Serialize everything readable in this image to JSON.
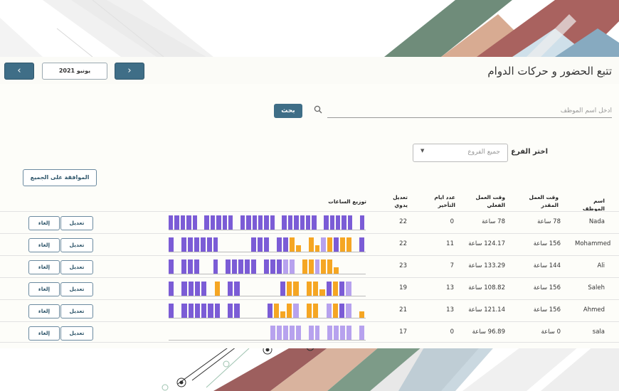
{
  "header": {
    "title": "تتبع الحضور و حركات الدوام",
    "month": "يونيو 2021",
    "prev_label": "‹",
    "next_label": "›"
  },
  "search": {
    "placeholder": "أدخل اسم الموظف",
    "button_label": "بحث"
  },
  "filter": {
    "label": "اختر الفرع",
    "selected": "جميع الفروع"
  },
  "approve_all_label": "الموافقة على الجميع",
  "table": {
    "headers": {
      "name": "اسم الموظف",
      "planned": "وقت العمل المقدر",
      "actual": "وقت العمل الفعلي",
      "late_days": "عدد ايام التأخير",
      "manual_edit": "تعديل يدوي",
      "distribution": "توزيع الساعات"
    },
    "edit_label": "تعديل",
    "cancel_label": "إلغاء",
    "rows": [
      {
        "name": "Nada",
        "planned": "78 ساعة",
        "actual": "78 ساعة",
        "late": "0",
        "manual": "22",
        "days": [
          "P",
          "P",
          "P",
          "P",
          "P",
          "E",
          "P",
          "P",
          "P",
          "P",
          "P",
          "E",
          "P",
          "P",
          "P",
          "P",
          "P",
          "P",
          "E",
          "P",
          "P",
          "P",
          "P",
          "P",
          "P",
          "E",
          "P",
          "P",
          "P",
          "P",
          "P",
          "E",
          "P"
        ]
      },
      {
        "name": "Mohammed",
        "planned": "156 ساعة",
        "actual": "124.17 ساعة",
        "late": "11",
        "manual": "22",
        "days": [
          "P",
          "E",
          "P",
          "P",
          "P",
          "P",
          "P",
          "P",
          "E",
          "E",
          "E",
          "E",
          "E",
          "P",
          "P",
          "P",
          "E",
          "P",
          "P",
          "O",
          "O",
          "E",
          "O",
          "O",
          "L",
          "O",
          "P",
          "O",
          "O",
          "E",
          "P"
        ]
      },
      {
        "name": "Ali",
        "planned": "144 ساعة",
        "actual": "133.29 ساعة",
        "late": "7",
        "manual": "23",
        "days": [
          "P",
          "E",
          "P",
          "P",
          "P",
          "E",
          "E",
          "P",
          "E",
          "P",
          "P",
          "P",
          "P",
          "P",
          "E",
          "P",
          "P",
          "P",
          "L",
          "L",
          "E",
          "O",
          "O",
          "L",
          "O",
          "O",
          "O",
          "E",
          "E",
          "E",
          "E"
        ]
      },
      {
        "name": "Saleh",
        "planned": "156 ساعة",
        "actual": "108.82 ساعة",
        "late": "13",
        "manual": "19",
        "days": [
          "P",
          "E",
          "P",
          "P",
          "P",
          "P",
          "E",
          "O",
          "E",
          "P",
          "P",
          "E",
          "E",
          "E",
          "E",
          "E",
          "E",
          "P",
          "O",
          "O",
          "E",
          "O",
          "O",
          "O",
          "P",
          "O",
          "P",
          "L",
          "E",
          "E"
        ]
      },
      {
        "name": "Ahmed",
        "planned": "156 ساعة",
        "actual": "121.14 ساعة",
        "late": "13",
        "manual": "21",
        "days": [
          "P",
          "E",
          "P",
          "P",
          "P",
          "P",
          "P",
          "P",
          "E",
          "P",
          "P",
          "E",
          "E",
          "E",
          "E",
          "P",
          "O",
          "O",
          "O",
          "L",
          "E",
          "O",
          "O",
          "E",
          "L",
          "O",
          "P",
          "L",
          "E",
          "O"
        ]
      },
      {
        "name": "sala",
        "planned": "0 ساعة",
        "actual": "96.89 ساعة",
        "late": "0",
        "manual": "17",
        "days": [
          "E",
          "E",
          "E",
          "E",
          "E",
          "E",
          "E",
          "E",
          "E",
          "E",
          "E",
          "E",
          "E",
          "E",
          "E",
          "E",
          "L",
          "L",
          "L",
          "L",
          "L",
          "E",
          "L",
          "L",
          "E",
          "L",
          "L",
          "L",
          "L",
          "E",
          "L"
        ]
      }
    ]
  },
  "colors": {
    "nav_button": "#3f6e87",
    "bar_present": "#7b5cd6",
    "bar_late": "#f5a623",
    "bar_partial": "#b7a2ee"
  }
}
